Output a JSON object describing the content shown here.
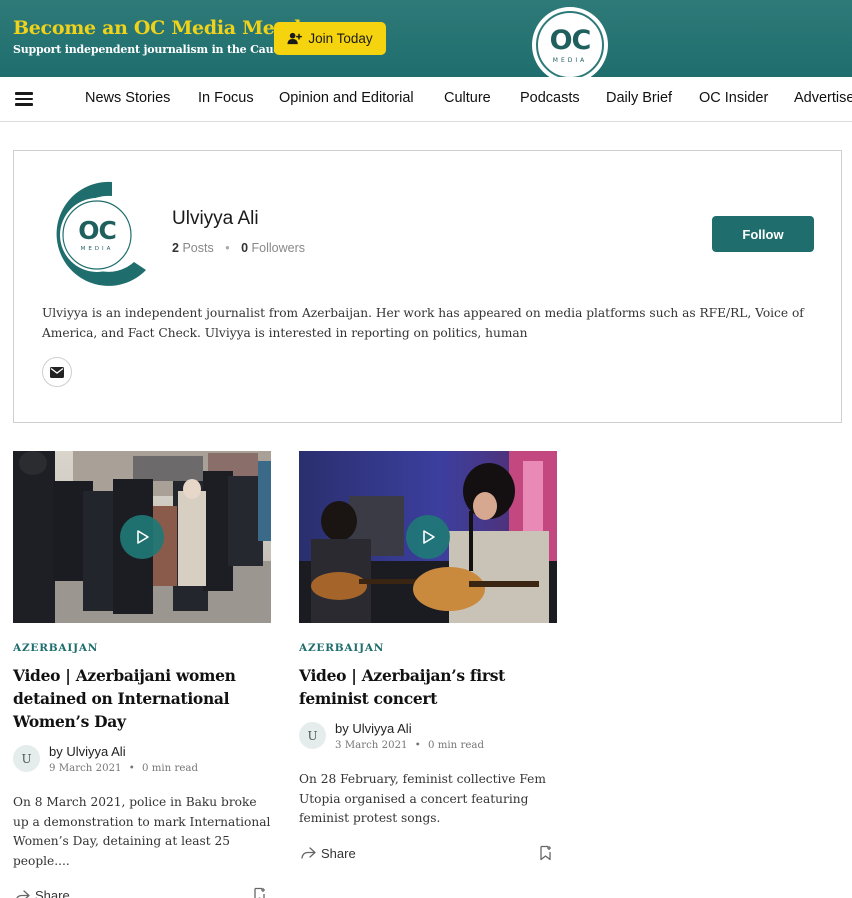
{
  "banner": {
    "title": "Become an OC Media Member",
    "subtitle": "Support independent journalism in the Caucasus",
    "join_label": "Join Today",
    "logo_text": "OC",
    "logo_sub": "MEDIA"
  },
  "nav": {
    "items": [
      "News Stories",
      "In Focus",
      "Opinion and Editorial",
      "Culture",
      "Podcasts",
      "Daily Brief",
      "OC Insider",
      "Advertise"
    ]
  },
  "profile": {
    "name": "Ulviyya Ali",
    "posts_count": "2",
    "posts_label": "Posts",
    "followers_count": "0",
    "followers_label": "Followers",
    "follow_label": "Follow",
    "bio": "Ulviyya is an independent journalist from Azerbaijan. Her work has appeared on media platforms such as RFE/RL, Voice of America, and Fact Check. Ulviyya is interested in reporting on politics, human",
    "avatar_text": "OC",
    "avatar_sub": "MEDIA"
  },
  "articles": [
    {
      "category": "AZERBAIJAN",
      "title": "Video | Azerbaijani women detained on International Women’s Day",
      "author_initial": "U",
      "byline": "by Ulviyya Ali",
      "date": "9 March 2021",
      "read_time": "0 min read",
      "excerpt": " On 8 March 2021, police in Baku broke up a demonstration to mark International Women’s Day, detaining at least 25 people....",
      "share_label": "Share"
    },
    {
      "category": "AZERBAIJAN",
      "title": "Video | Azerbaijan’s first feminist concert",
      "author_initial": "U",
      "byline": "by Ulviyya Ali",
      "date": "3 March 2021",
      "read_time": "0 min read",
      "excerpt": " On 28 February, feminist collective Fem Utopia organised a concert featuring feminist protest songs.",
      "share_label": "Share"
    }
  ],
  "colors": {
    "brand_teal": "#1f6e6d",
    "banner_yellow": "#f5d40f"
  },
  "icons": [
    "add-person-icon",
    "hamburger-menu-icon",
    "mail-icon",
    "play-icon",
    "share-icon",
    "bookmark-icon"
  ]
}
